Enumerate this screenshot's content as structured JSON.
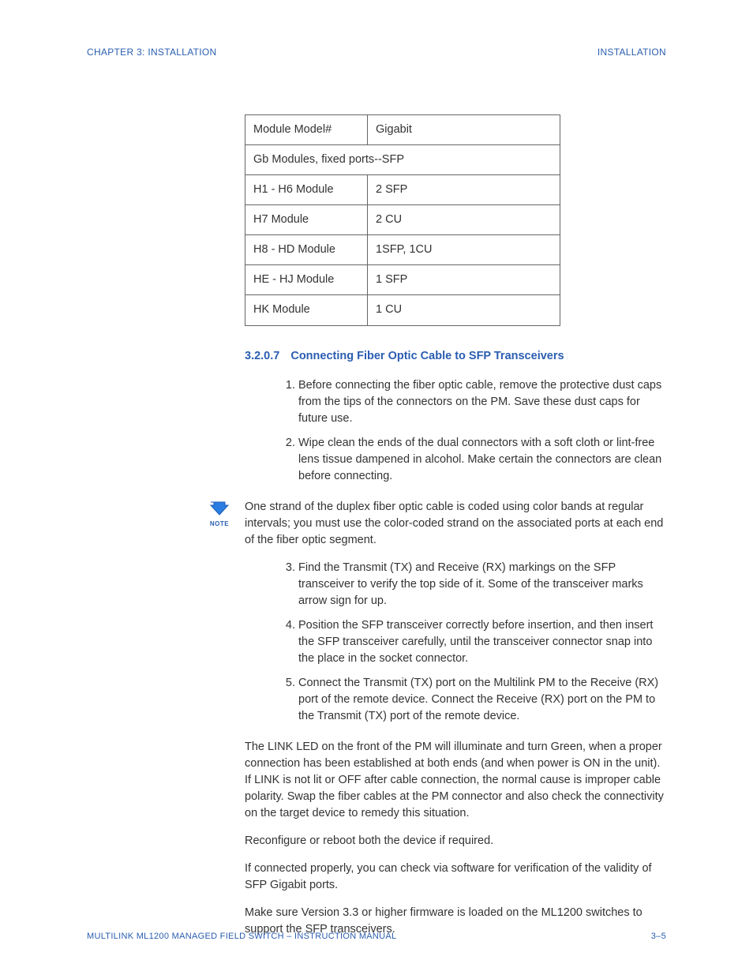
{
  "header": {
    "left": "CHAPTER 3: INSTALLATION",
    "right": "INSTALLATION"
  },
  "table": {
    "r0c0": "Module Model#",
    "r0c1": "Gigabit",
    "r1": "Gb Modules, fixed ports--SFP",
    "r2c0": "H1 - H6 Module",
    "r2c1": "2 SFP",
    "r3c0": "H7 Module",
    "r3c1": "2 CU",
    "r4c0": "H8 - HD Module",
    "r4c1": "1SFP, 1CU",
    "r5c0": "HE - HJ Module",
    "r5c1": "1 SFP",
    "r6c0": "HK Module",
    "r6c1": "1 CU"
  },
  "section": {
    "number": "3.2.0.7",
    "title": "Connecting Fiber Optic Cable to SFP Transceivers"
  },
  "steps_a": {
    "n1": "1.",
    "t1": "Before connecting the fiber optic cable, remove the protective dust caps from the tips of the connectors on the PM.  Save these dust caps for future use.",
    "n2": "2.",
    "t2": "Wipe clean the ends of the dual connectors with a soft cloth or lint-free lens tissue dampened in alcohol.  Make certain the connectors are clean before connecting."
  },
  "note": {
    "label": "NOTE",
    "text": "One strand of the duplex fiber optic cable is coded using color bands at regular intervals; you must use the color-coded strand on the associated ports at each end of the fiber optic segment."
  },
  "steps_b": {
    "n3": "3.",
    "t3": "Find the Transmit (TX) and Receive (RX) markings on the SFP transceiver to verify the top side of it. Some of the transceiver marks arrow sign for up.",
    "n4": "4.",
    "t4": "Position the SFP transceiver correctly before insertion, and then insert the SFP transceiver carefully, until the transceiver connector snap into the place in the socket connector.",
    "n5": "5.",
    "t5": "Connect the Transmit (TX) port on the Multilink PM to the Receive (RX) port of the remote device. Connect the Receive (RX) port on the PM to the Transmit (TX) port of the remote device."
  },
  "paras": {
    "p1": "The LINK LED on the front of the PM will illuminate and turn Green, when a proper connection has been established at both ends (and when power is ON in the unit). If LINK is not lit or OFF after cable connection, the normal cause is improper cable polarity.  Swap the fiber cables at the PM connector and also check the connectivity on the target device to remedy this situation.",
    "p2": "Reconfigure or reboot both the device if required.",
    "p3": "If connected properly, you can check via software for verification of the validity of SFP Gigabit ports.",
    "p4": "Make sure Version 3.3 or higher firmware is loaded on the ML1200 switches to support the SFP transceivers."
  },
  "footer": {
    "left": "MULTILINK ML1200 MANAGED FIELD SWITCH – INSTRUCTION MANUAL",
    "right": "3–5"
  }
}
